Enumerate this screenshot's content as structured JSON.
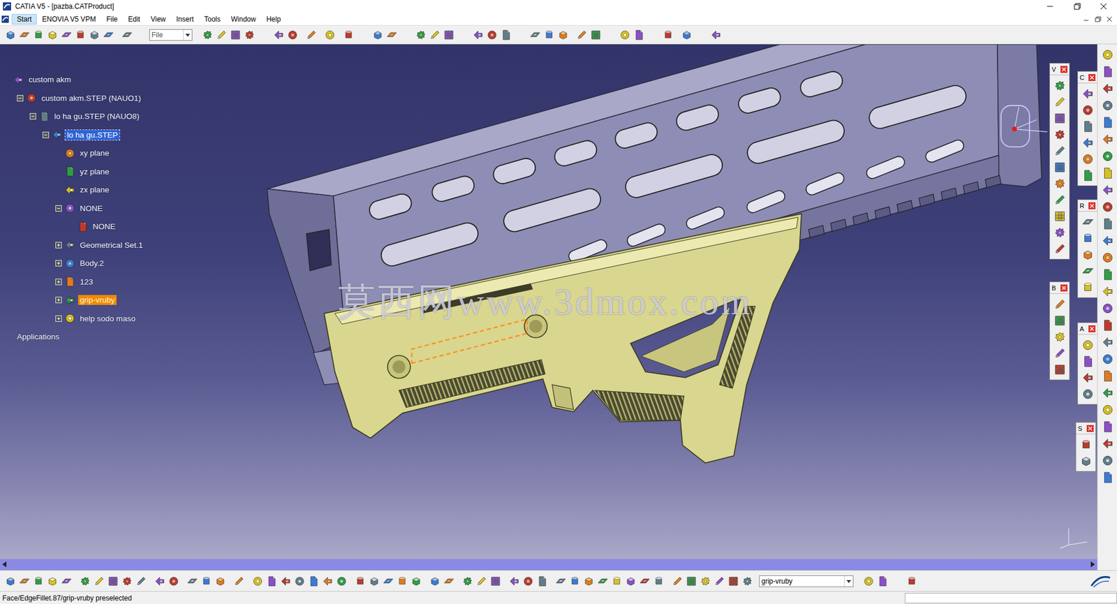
{
  "window": {
    "title": "CATIA V5 - [pazba.CATProduct]"
  },
  "menu": [
    {
      "label": "Start",
      "selected": true
    },
    {
      "label": "ENOVIA V5 VPM",
      "selected": false
    },
    {
      "label": "File",
      "selected": false
    },
    {
      "label": "Edit",
      "selected": false
    },
    {
      "label": "View",
      "selected": false
    },
    {
      "label": "Insert",
      "selected": false
    },
    {
      "label": "Tools",
      "selected": false
    },
    {
      "label": "Window",
      "selected": false
    },
    {
      "label": "Help",
      "selected": false
    }
  ],
  "toolbar": {
    "combo": "File"
  },
  "tree": [
    {
      "label": "custom akm",
      "depth": 0,
      "toggle": "none",
      "kind": "node",
      "selected": false,
      "preselected": false
    },
    {
      "label": "custom akm.STEP (NAUO1)",
      "depth": 1,
      "toggle": "expanded",
      "kind": "node",
      "selected": false,
      "preselected": false
    },
    {
      "label": "lo ha gu.STEP (NAUO8)",
      "depth": 2,
      "toggle": "expanded",
      "kind": "node",
      "selected": false,
      "preselected": false
    },
    {
      "label": "lo ha gu.STEP",
      "depth": 3,
      "toggle": "expanded",
      "kind": "node",
      "selected": true,
      "preselected": false
    },
    {
      "label": "xy plane",
      "depth": 4,
      "toggle": "none",
      "kind": "node",
      "selected": false,
      "preselected": false
    },
    {
      "label": "yz plane",
      "depth": 4,
      "toggle": "none",
      "kind": "node",
      "selected": false,
      "preselected": false
    },
    {
      "label": "zx plane",
      "depth": 4,
      "toggle": "none",
      "kind": "node",
      "selected": false,
      "preselected": false
    },
    {
      "label": "NONE",
      "depth": 4,
      "toggle": "expanded",
      "kind": "node",
      "selected": false,
      "preselected": false
    },
    {
      "label": "NONE",
      "depth": 5,
      "toggle": "none",
      "kind": "node",
      "selected": false,
      "preselected": false
    },
    {
      "label": "Geometrical Set.1",
      "depth": 4,
      "toggle": "collapsed",
      "kind": "node",
      "selected": false,
      "preselected": false
    },
    {
      "label": "Body.2",
      "depth": 4,
      "toggle": "collapsed",
      "kind": "node",
      "selected": false,
      "preselected": false
    },
    {
      "label": "123",
      "depth": 4,
      "toggle": "collapsed",
      "kind": "node",
      "selected": false,
      "preselected": false
    },
    {
      "label": "grip-vruby",
      "depth": 4,
      "toggle": "collapsed",
      "kind": "node",
      "selected": false,
      "preselected": true
    },
    {
      "label": "help sodo maso",
      "depth": 4,
      "toggle": "collapsed",
      "kind": "node",
      "selected": false,
      "preselected": false
    },
    {
      "label": "Applications",
      "depth": 0,
      "toggle": "none",
      "kind": "section",
      "selected": false,
      "preselected": false
    }
  ],
  "floating_toolbars": [
    {
      "title": "V"
    },
    {
      "title": "C"
    },
    {
      "title": "R"
    },
    {
      "title": "B"
    },
    {
      "title": "A"
    },
    {
      "title": "S"
    }
  ],
  "viewport": {
    "watermark": "莫西网www.3dmox.com"
  },
  "bottom_toolbar": {
    "combo": "grip-vruby"
  },
  "status_bar": {
    "message": "Face/EdgeFillet.87/grip-vruby preselected"
  }
}
